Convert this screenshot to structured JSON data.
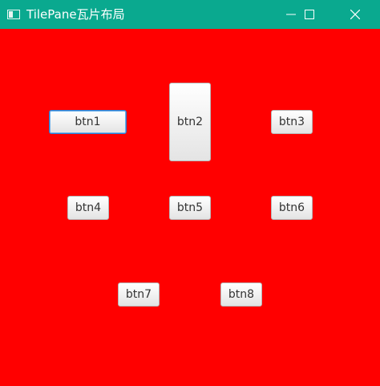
{
  "window": {
    "title": "TilePane瓦片布局",
    "icon": "window-app-icon",
    "titlebar_color": "#0aa98f",
    "background_color": "#ff0000"
  },
  "controls": {
    "minimize_icon": "minimize-icon",
    "maximize_icon": "maximize-icon",
    "close_icon": "close-icon"
  },
  "buttons": [
    {
      "label": "btn1",
      "focused": true
    },
    {
      "label": "btn2"
    },
    {
      "label": "btn3"
    },
    {
      "label": "btn4"
    },
    {
      "label": "btn5"
    },
    {
      "label": "btn6"
    },
    {
      "label": "btn7"
    },
    {
      "label": "btn8"
    }
  ]
}
